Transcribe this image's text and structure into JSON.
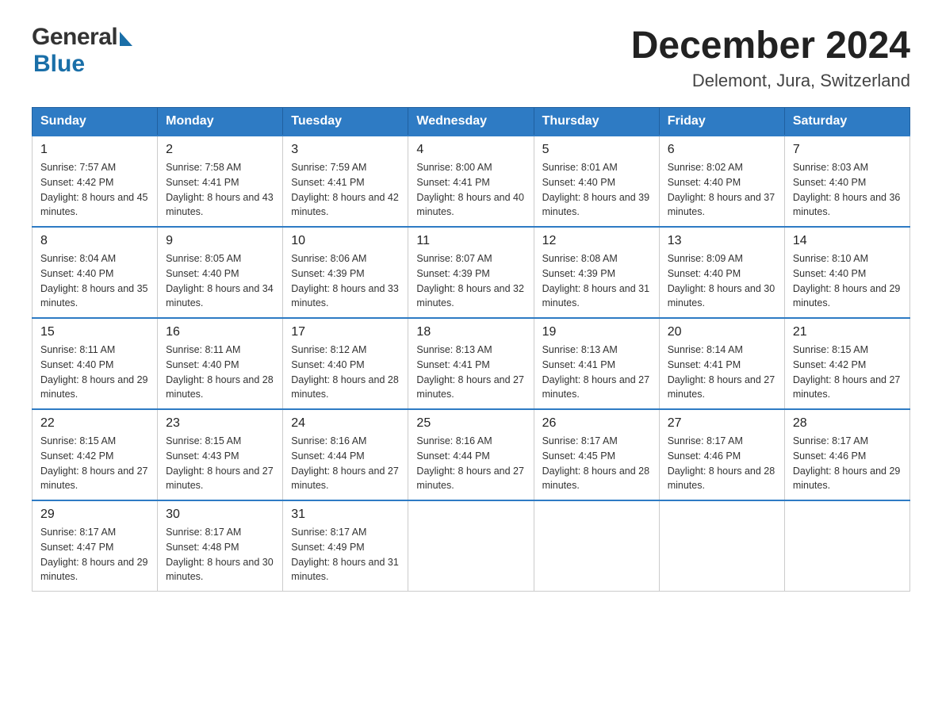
{
  "header": {
    "logo_general": "General",
    "logo_blue": "Blue",
    "month_title": "December 2024",
    "location": "Delemont, Jura, Switzerland"
  },
  "days_of_week": [
    "Sunday",
    "Monday",
    "Tuesday",
    "Wednesday",
    "Thursday",
    "Friday",
    "Saturday"
  ],
  "weeks": [
    [
      {
        "day": "1",
        "sunrise": "7:57 AM",
        "sunset": "4:42 PM",
        "daylight": "8 hours and 45 minutes."
      },
      {
        "day": "2",
        "sunrise": "7:58 AM",
        "sunset": "4:41 PM",
        "daylight": "8 hours and 43 minutes."
      },
      {
        "day": "3",
        "sunrise": "7:59 AM",
        "sunset": "4:41 PM",
        "daylight": "8 hours and 42 minutes."
      },
      {
        "day": "4",
        "sunrise": "8:00 AM",
        "sunset": "4:41 PM",
        "daylight": "8 hours and 40 minutes."
      },
      {
        "day": "5",
        "sunrise": "8:01 AM",
        "sunset": "4:40 PM",
        "daylight": "8 hours and 39 minutes."
      },
      {
        "day": "6",
        "sunrise": "8:02 AM",
        "sunset": "4:40 PM",
        "daylight": "8 hours and 37 minutes."
      },
      {
        "day": "7",
        "sunrise": "8:03 AM",
        "sunset": "4:40 PM",
        "daylight": "8 hours and 36 minutes."
      }
    ],
    [
      {
        "day": "8",
        "sunrise": "8:04 AM",
        "sunset": "4:40 PM",
        "daylight": "8 hours and 35 minutes."
      },
      {
        "day": "9",
        "sunrise": "8:05 AM",
        "sunset": "4:40 PM",
        "daylight": "8 hours and 34 minutes."
      },
      {
        "day": "10",
        "sunrise": "8:06 AM",
        "sunset": "4:39 PM",
        "daylight": "8 hours and 33 minutes."
      },
      {
        "day": "11",
        "sunrise": "8:07 AM",
        "sunset": "4:39 PM",
        "daylight": "8 hours and 32 minutes."
      },
      {
        "day": "12",
        "sunrise": "8:08 AM",
        "sunset": "4:39 PM",
        "daylight": "8 hours and 31 minutes."
      },
      {
        "day": "13",
        "sunrise": "8:09 AM",
        "sunset": "4:40 PM",
        "daylight": "8 hours and 30 minutes."
      },
      {
        "day": "14",
        "sunrise": "8:10 AM",
        "sunset": "4:40 PM",
        "daylight": "8 hours and 29 minutes."
      }
    ],
    [
      {
        "day": "15",
        "sunrise": "8:11 AM",
        "sunset": "4:40 PM",
        "daylight": "8 hours and 29 minutes."
      },
      {
        "day": "16",
        "sunrise": "8:11 AM",
        "sunset": "4:40 PM",
        "daylight": "8 hours and 28 minutes."
      },
      {
        "day": "17",
        "sunrise": "8:12 AM",
        "sunset": "4:40 PM",
        "daylight": "8 hours and 28 minutes."
      },
      {
        "day": "18",
        "sunrise": "8:13 AM",
        "sunset": "4:41 PM",
        "daylight": "8 hours and 27 minutes."
      },
      {
        "day": "19",
        "sunrise": "8:13 AM",
        "sunset": "4:41 PM",
        "daylight": "8 hours and 27 minutes."
      },
      {
        "day": "20",
        "sunrise": "8:14 AM",
        "sunset": "4:41 PM",
        "daylight": "8 hours and 27 minutes."
      },
      {
        "day": "21",
        "sunrise": "8:15 AM",
        "sunset": "4:42 PM",
        "daylight": "8 hours and 27 minutes."
      }
    ],
    [
      {
        "day": "22",
        "sunrise": "8:15 AM",
        "sunset": "4:42 PM",
        "daylight": "8 hours and 27 minutes."
      },
      {
        "day": "23",
        "sunrise": "8:15 AM",
        "sunset": "4:43 PM",
        "daylight": "8 hours and 27 minutes."
      },
      {
        "day": "24",
        "sunrise": "8:16 AM",
        "sunset": "4:44 PM",
        "daylight": "8 hours and 27 minutes."
      },
      {
        "day": "25",
        "sunrise": "8:16 AM",
        "sunset": "4:44 PM",
        "daylight": "8 hours and 27 minutes."
      },
      {
        "day": "26",
        "sunrise": "8:17 AM",
        "sunset": "4:45 PM",
        "daylight": "8 hours and 28 minutes."
      },
      {
        "day": "27",
        "sunrise": "8:17 AM",
        "sunset": "4:46 PM",
        "daylight": "8 hours and 28 minutes."
      },
      {
        "day": "28",
        "sunrise": "8:17 AM",
        "sunset": "4:46 PM",
        "daylight": "8 hours and 29 minutes."
      }
    ],
    [
      {
        "day": "29",
        "sunrise": "8:17 AM",
        "sunset": "4:47 PM",
        "daylight": "8 hours and 29 minutes."
      },
      {
        "day": "30",
        "sunrise": "8:17 AM",
        "sunset": "4:48 PM",
        "daylight": "8 hours and 30 minutes."
      },
      {
        "day": "31",
        "sunrise": "8:17 AM",
        "sunset": "4:49 PM",
        "daylight": "8 hours and 31 minutes."
      },
      null,
      null,
      null,
      null
    ]
  ],
  "labels": {
    "sunrise": "Sunrise:",
    "sunset": "Sunset:",
    "daylight": "Daylight:"
  }
}
